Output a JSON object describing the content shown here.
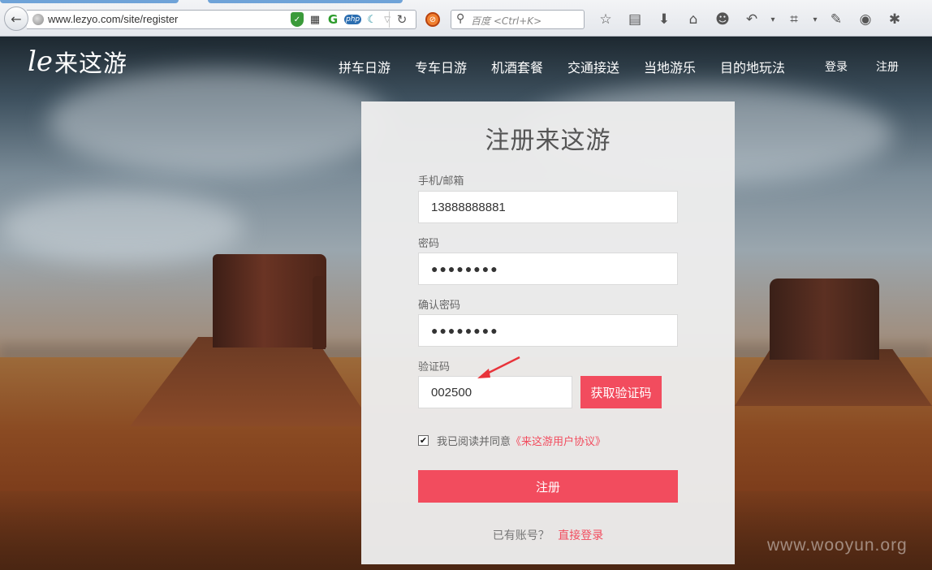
{
  "browser": {
    "url": "www.lezyo.com/site/register",
    "search_placeholder": "百度 <Ctrl+K>",
    "back_icon": "←",
    "reload_icon": "↻",
    "url_icons": [
      "shield-icon",
      "qr-code-icon",
      "grammarly-icon",
      "php-icon",
      "wave-icon",
      "dropdown-icon"
    ],
    "toolbar_icons": [
      "star-icon",
      "reading-list-icon",
      "download-icon",
      "home-icon",
      "chat-icon",
      "undo-icon",
      "crop-icon",
      "comment-icon",
      "avatar-icon",
      "extension-icon"
    ]
  },
  "site": {
    "logo_mark": "le",
    "logo_text": "来这游",
    "nav_items": [
      "拼车日游",
      "专车日游",
      "机酒套餐",
      "交通接送",
      "当地游乐",
      "目的地玩法"
    ],
    "login_label": "登录",
    "register_label": "注册"
  },
  "form": {
    "title": "注册来这游",
    "account_label": "手机/邮箱",
    "account_value": "13888888881",
    "password_label": "密码",
    "password_value": "●●●●●●●●",
    "confirm_label": "确认密码",
    "confirm_value": "●●●●●●●●",
    "captcha_label": "验证码",
    "captcha_value": "002500",
    "get_code_label": "获取验证码",
    "agree_checked": true,
    "agree_text": "我已阅读并同意",
    "agree_link": "《来这游用户协议》",
    "submit_label": "注册",
    "have_account_text": "已有账号？",
    "direct_login_label": "直接登录"
  },
  "colors": {
    "accent": "#f24c5e",
    "panel_bg": "#ececec"
  },
  "watermark": "www.wooyun.org"
}
